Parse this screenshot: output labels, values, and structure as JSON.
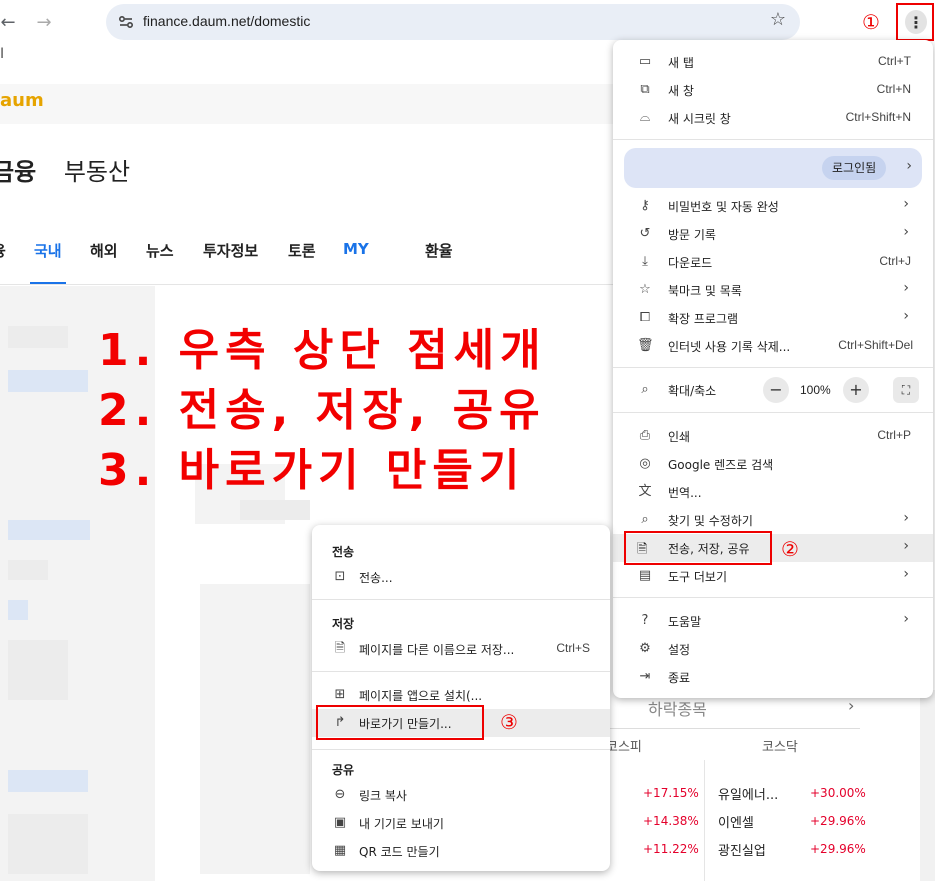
{
  "browser": {
    "url": "finance.daum.net/domestic",
    "back_icon": "arrow-left-icon",
    "forward_icon": "arrow-right-icon",
    "menu_marker": "①"
  },
  "page": {
    "logo": "aum",
    "title_bold": "금융",
    "title_rest": "부동산",
    "nav": [
      "융",
      "국내",
      "해외",
      "뉴스",
      "투자정보",
      "토론",
      "MY",
      "환율"
    ],
    "annotation_lines": [
      "1. 우측 상단 점세개",
      "2. 전송, 저장, 공유",
      "3. 바로가기 만들기"
    ],
    "stocks": {
      "tab_fall": "하락종목",
      "col_left": "코스피",
      "col_right": "코스닥",
      "rows": [
        {
          "l_name": "",
          "l_pct": "+17.15%",
          "r_name": "유일에너...",
          "r_pct": "+30.00%"
        },
        {
          "l_name": "",
          "l_pct": "+14.38%",
          "r_name": "이엔셀",
          "r_pct": "+29.96%"
        },
        {
          "l_name": "",
          "l_pct": "+11.22%",
          "r_name": "광진실업",
          "r_pct": "+29.96%"
        }
      ]
    }
  },
  "menu": {
    "new_tab": "새 탭",
    "new_tab_sc": "Ctrl+T",
    "new_window": "새 창",
    "new_window_sc": "Ctrl+N",
    "incognito": "새 시크릿 창",
    "incognito_sc": "Ctrl+Shift+N",
    "profile_status": "로그인됨",
    "passwords": "비밀번호 및 자동 완성",
    "history": "방문 기록",
    "downloads": "다운로드",
    "downloads_sc": "Ctrl+J",
    "bookmarks": "북마크 및 목록",
    "extensions": "확장 프로그램",
    "clear_data": "인터넷 사용 기록 삭제...",
    "clear_data_sc": "Ctrl+Shift+Del",
    "zoom_label": "확대/축소",
    "zoom_value": "100%",
    "zoom_minus": "−",
    "zoom_plus": "+",
    "print": "인쇄",
    "print_sc": "Ctrl+P",
    "lens": "Google 렌즈로 검색",
    "translate": "번역...",
    "find": "찾기 및 수정하기",
    "cast_save_share": "전송, 저장, 공유",
    "cast_save_share_marker": "②",
    "more_tools": "도구 더보기",
    "help": "도움말",
    "settings": "설정",
    "exit": "종료"
  },
  "submenu": {
    "cast_header": "전송",
    "cast": "전송...",
    "save_header": "저장",
    "save_as": "페이지를 다른 이름으로 저장...",
    "save_as_sc": "Ctrl+S",
    "install_app": "페이지를 앱으로 설치(...",
    "create_shortcut": "바로가기 만들기...",
    "create_shortcut_marker": "③",
    "share_header": "공유",
    "copy_link": "링크 복사",
    "send_to_devices": "내 기기로 보내기",
    "qr_code": "QR 코드 만들기"
  }
}
